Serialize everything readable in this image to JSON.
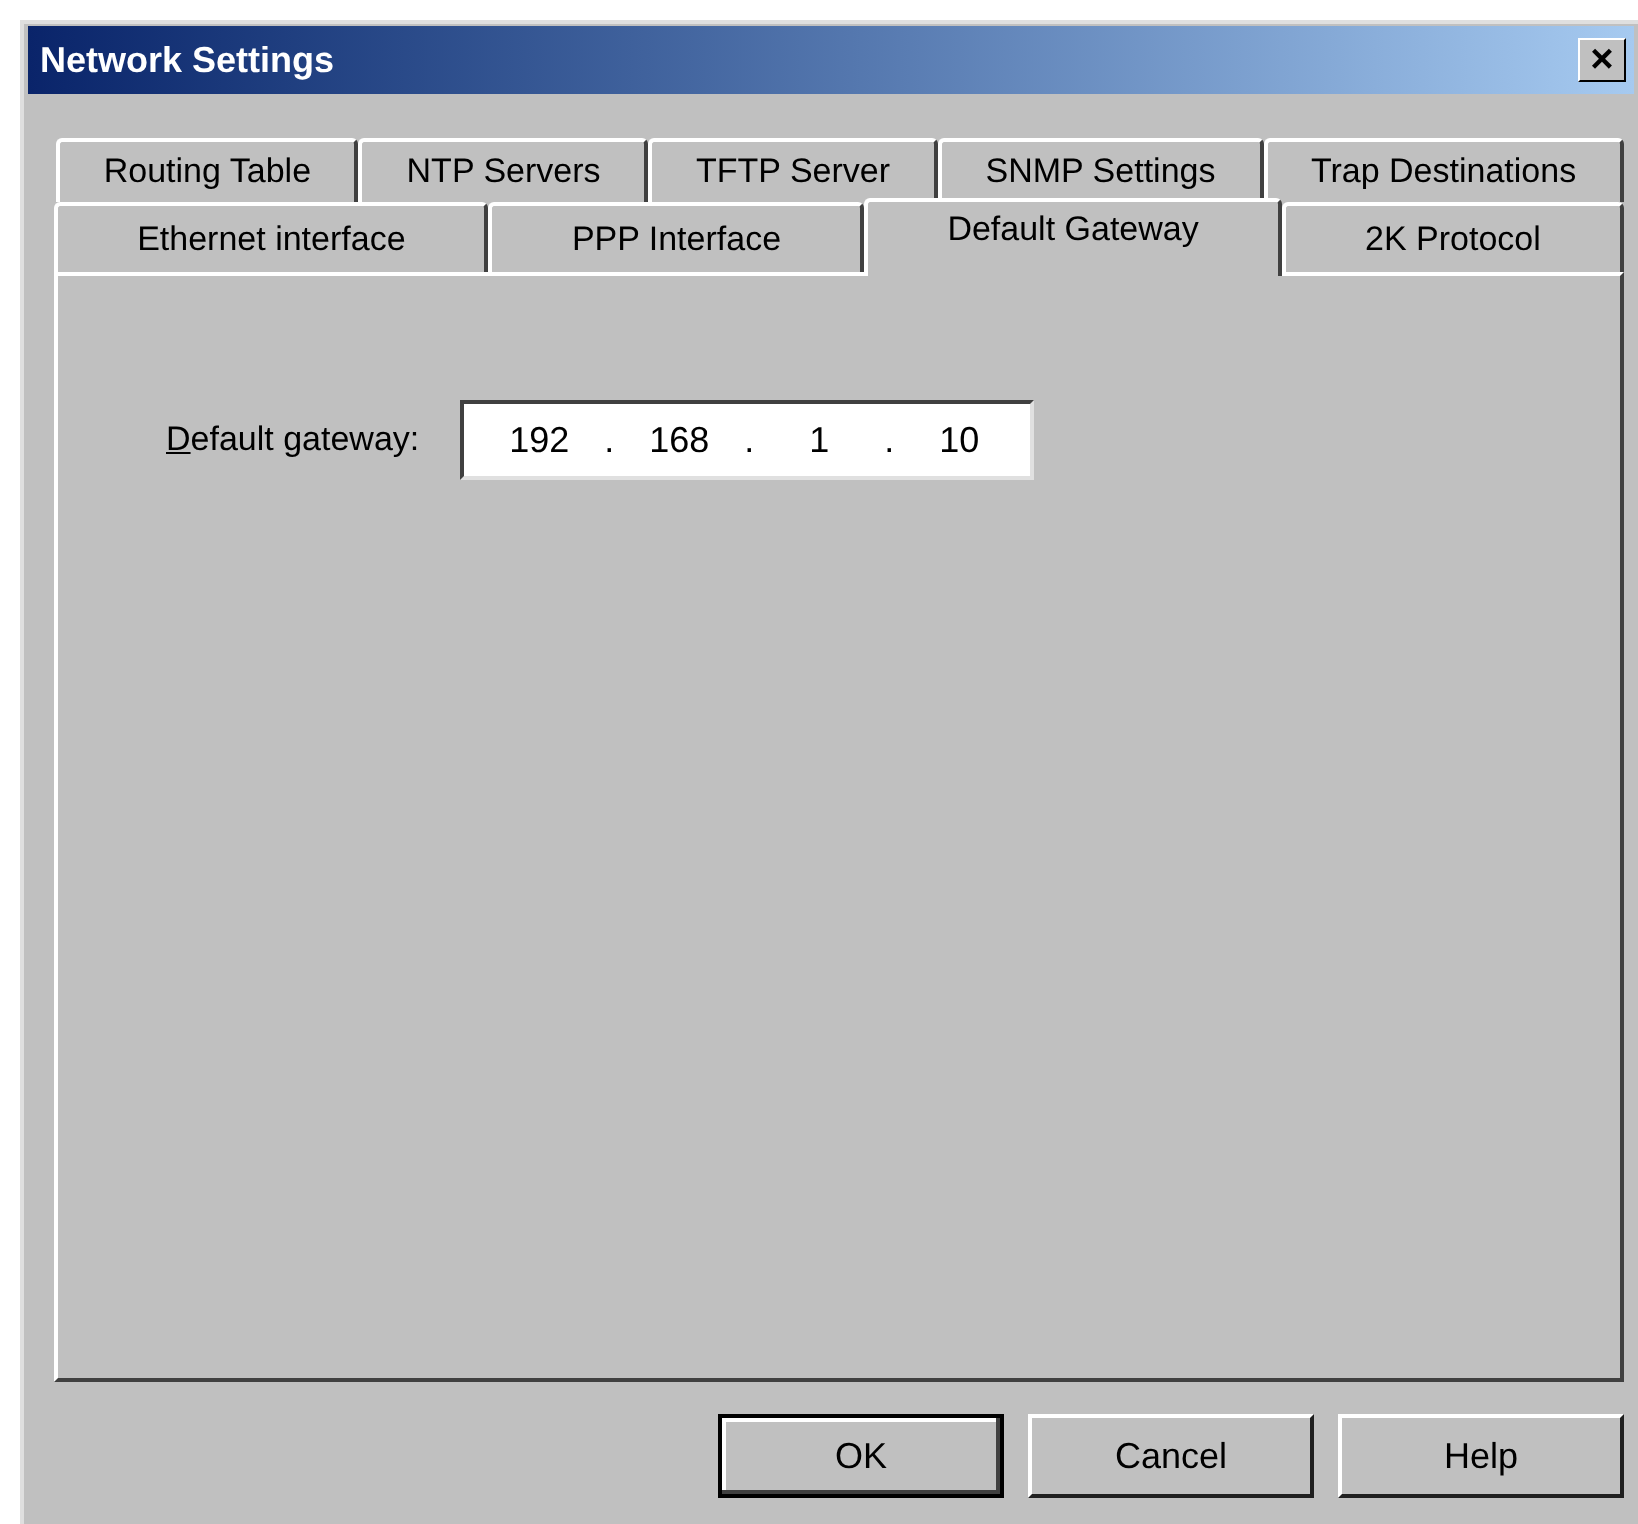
{
  "window": {
    "title": "Network Settings",
    "close": "×"
  },
  "tab_rows": [
    [
      {
        "label": "Routing Table",
        "selected": false
      },
      {
        "label": "NTP Servers",
        "selected": false
      },
      {
        "label": "TFTP Server",
        "selected": false
      },
      {
        "label": "SNMP Settings",
        "selected": false
      },
      {
        "label": "Trap Destinations",
        "selected": false
      }
    ],
    [
      {
        "label": "Ethernet interface",
        "selected": false
      },
      {
        "label": "PPP Interface",
        "selected": false
      },
      {
        "label": "Default Gateway",
        "selected": true
      },
      {
        "label": "2K Protocol",
        "selected": false
      }
    ]
  ],
  "gateway": {
    "label": "Default gateway:",
    "first_letter_underlined": true,
    "octets": [
      "192",
      "168",
      "1",
      "10"
    ],
    "separators": [
      ".",
      ".",
      "."
    ]
  },
  "buttons": [
    {
      "label": "OK",
      "default": true
    },
    {
      "label": "Cancel",
      "default": false
    },
    {
      "label": "Help",
      "default": false
    }
  ]
}
